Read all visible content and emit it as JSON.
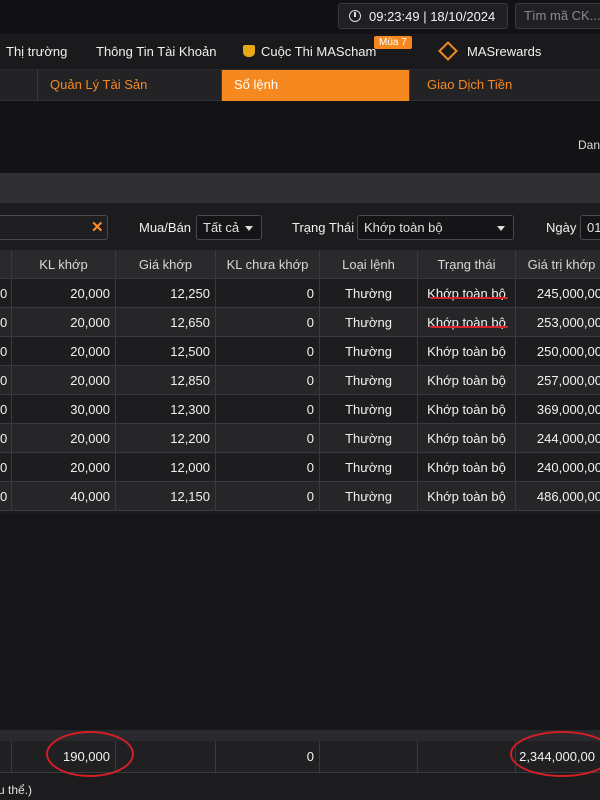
{
  "topbar": {
    "time": "09:23:49 | 18/10/2024",
    "search_placeholder": "Tìm mã CK..."
  },
  "menu": {
    "items": [
      "Thị trường",
      "Thông Tin Tài Khoản",
      "Cuộc Thi MAScham",
      "MASrewards"
    ],
    "badge": "Mùa 7"
  },
  "tabs": {
    "items": [
      "Quản Lý Tài Sản",
      "Sổ lệnh",
      "Giao Dịch Tiền"
    ],
    "active": "Sổ lệnh"
  },
  "header_right": "Dan",
  "filters": {
    "side_label": "Mua/Bán",
    "side_value": "Tất cả",
    "status_label": "Trạng Thái",
    "status_value": "Khớp toàn bộ",
    "date_label": "Ngày",
    "date_value": "01"
  },
  "table": {
    "columns": [
      "KL khớp",
      "Giá khớp",
      "KL chưa khớp",
      "Loại lệnh",
      "Trạng thái",
      "Giá trị khớp"
    ],
    "rows": [
      {
        "lead": "0",
        "qty": "20,000",
        "price": "12,250",
        "unfilled": "0",
        "type": "Thường",
        "status": "Khớp toàn bộ",
        "value": "245,000,00"
      },
      {
        "lead": "0",
        "qty": "20,000",
        "price": "12,650",
        "unfilled": "0",
        "type": "Thường",
        "status": "Khớp toàn bộ",
        "value": "253,000,00"
      },
      {
        "lead": "0",
        "qty": "20,000",
        "price": "12,500",
        "unfilled": "0",
        "type": "Thường",
        "status": "Khớp toàn bộ",
        "value": "250,000,00"
      },
      {
        "lead": "0",
        "qty": "20,000",
        "price": "12,850",
        "unfilled": "0",
        "type": "Thường",
        "status": "Khớp toàn bộ",
        "value": "257,000,00"
      },
      {
        "lead": "0",
        "qty": "30,000",
        "price": "12,300",
        "unfilled": "0",
        "type": "Thường",
        "status": "Khớp toàn bộ",
        "value": "369,000,00"
      },
      {
        "lead": "0",
        "qty": "20,000",
        "price": "12,200",
        "unfilled": "0",
        "type": "Thường",
        "status": "Khớp toàn bộ",
        "value": "244,000,00"
      },
      {
        "lead": "0",
        "qty": "20,000",
        "price": "12,000",
        "unfilled": "0",
        "type": "Thường",
        "status": "Khớp toàn bộ",
        "value": "240,000,00"
      },
      {
        "lead": "0",
        "qty": "40,000",
        "price": "12,150",
        "unfilled": "0",
        "type": "Thường",
        "status": "Khớp toàn bộ",
        "value": "486,000,00"
      }
    ]
  },
  "summary": {
    "total_qty": "190,000",
    "total_unfilled": "0",
    "total_value": "2,344,000,00"
  },
  "footer_text": "u thể.)",
  "colors": {
    "accent": "#f5891f",
    "annotation_red": "#d31f25"
  }
}
